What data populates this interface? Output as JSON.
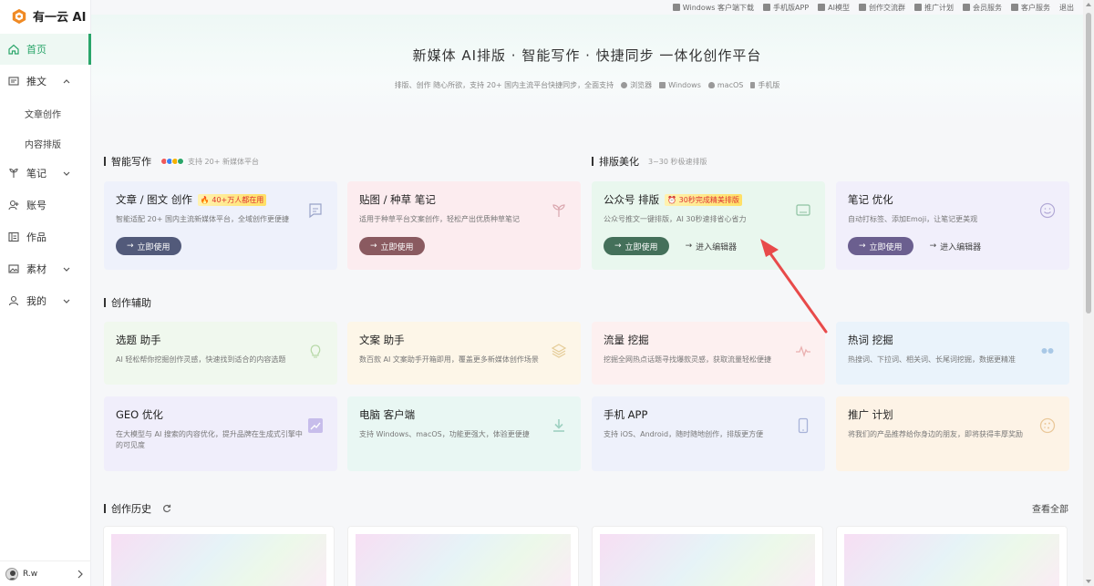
{
  "app": {
    "logo_text": "有一云 AI",
    "brand_color": "#f08a24",
    "accent": "#2aa56a"
  },
  "sidebar": {
    "items": [
      {
        "label": "首页",
        "icon": "home-icon",
        "active": true
      },
      {
        "label": "推文",
        "icon": "doc-icon",
        "expanded": true
      },
      {
        "label": "笔记",
        "icon": "note-icon"
      },
      {
        "label": "账号",
        "icon": "account-icon"
      },
      {
        "label": "作品",
        "icon": "works-icon"
      },
      {
        "label": "素材",
        "icon": "image-icon"
      },
      {
        "label": "我的",
        "icon": "user-icon"
      }
    ],
    "subitems": [
      "文章创作",
      "内容排版"
    ],
    "user_name": "R.w"
  },
  "topbar": {
    "links": [
      "Windows 客户端下载",
      "手机版APP",
      "AI模型",
      "创作交流群",
      "推广计划",
      "会员服务",
      "客户服务",
      "退出"
    ]
  },
  "hero": {
    "title": "新媒体 AI排版 · 智能写作 · 快捷同步 一体化创作平台",
    "subtitle": "排版、创作 随心所欲，支持 20+ 国内主流平台快捷同步，全面支持",
    "platforms": [
      "浏览器",
      "Windows",
      "macOS",
      "手机版"
    ]
  },
  "sections": {
    "writing": {
      "title": "智能写作",
      "note": "支持 20+ 新媒体平台"
    },
    "layout": {
      "title": "排版美化",
      "note": "3~30 秒极速排版"
    },
    "assist": {
      "title": "创作辅助"
    },
    "history": {
      "title": "创作历史",
      "view_all": "查看全部"
    }
  },
  "cards_top": [
    {
      "title": "文章 / 图文 创作",
      "badge": "🔥 40+万人都在用",
      "desc": "智能适配 20+ 国内主流新媒体平台，全域创作更便捷",
      "button": "立即使用",
      "icon": "chat-icon",
      "bg": "#eef1fb",
      "btn": "#525a7a"
    },
    {
      "title": "贴图 / 种草 笔记",
      "badge": "",
      "desc": "适用于种草平台文案创作，轻松产出优质种草笔记",
      "button": "立即使用",
      "icon": "sprout-icon",
      "bg": "#fcecef",
      "btn": "#8a5a60"
    },
    {
      "title": "公众号 排版",
      "badge": "⏰ 30秒完成精美排版",
      "desc": "公众号推文一键排版，AI 30秒速排省心省力",
      "button": "立即使用",
      "link": "进入编辑器",
      "icon": "layout-icon",
      "bg": "#e9f7ee",
      "btn": "#44705a"
    },
    {
      "title": "笔记 优化",
      "badge": "",
      "desc": "自动打标签、添加Emoji，让笔记更美观",
      "button": "立即使用",
      "link": "进入编辑器",
      "icon": "smile-icon",
      "bg": "#f1effb",
      "btn": "#6b5f8f"
    }
  ],
  "cards_assist": [
    {
      "title": "选题 助手",
      "desc": "AI 轻松帮你挖掘创作灵感，快速找到适合的内容选题",
      "icon": "bulb-icon",
      "bg": "#f0f8ee"
    },
    {
      "title": "文案 助手",
      "desc": "数百款 AI 文案助手开箱即用，覆盖更多新媒体创作场景",
      "icon": "layers-icon",
      "bg": "#fdf6e8"
    },
    {
      "title": "流量 挖掘",
      "desc": "挖掘全网热点话题寻找爆款灵感，获取流量轻松便捷",
      "icon": "pulse-icon",
      "bg": "#fdf0f0"
    },
    {
      "title": "热词 挖掘",
      "desc": "热搜词、下拉词、相关词、长尾词挖掘，数据更精准",
      "icon": "dots-icon",
      "bg": "#eaf3fb"
    },
    {
      "title": "GEO 优化",
      "desc": "在大模型与 AI 搜索的内容优化，提升品牌在生成式引擎中的可见度",
      "icon": "chart-up-icon",
      "bg": "#f0eefb"
    },
    {
      "title": "电脑 客户端",
      "desc": "支持 Windows、macOS，功能更强大，体验更便捷",
      "icon": "download-icon",
      "bg": "#e9f7f3"
    },
    {
      "title": "手机 APP",
      "desc": "支持 iOS、Android，随时随地创作，排版更方便",
      "icon": "phone-icon",
      "bg": "#eef1fb"
    },
    {
      "title": "推广 计划",
      "desc": "将我们的产品推荐给你身边的朋友，即将获得丰厚奖励",
      "icon": "cookie-icon",
      "bg": "#fdf3e6"
    }
  ]
}
